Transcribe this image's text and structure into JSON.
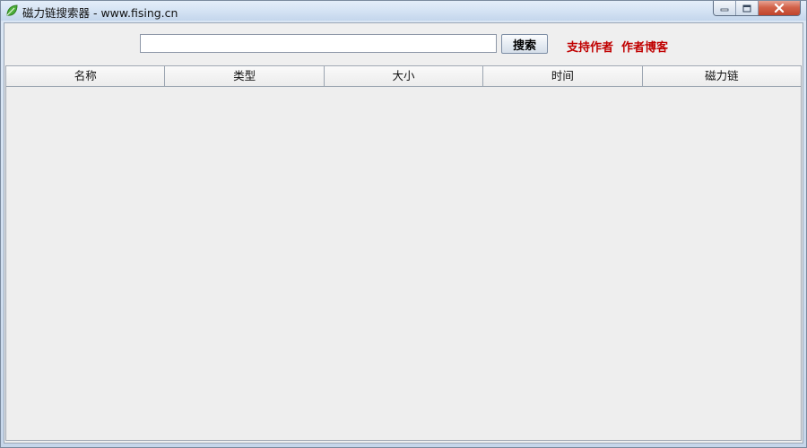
{
  "window": {
    "title": "磁力链搜索器 - www.fising.cn",
    "app_icon": "green-leaf-icon",
    "controls": [
      "minimize-icon",
      "maximize-icon",
      "close-icon"
    ]
  },
  "search": {
    "value": "",
    "placeholder": "",
    "button_label": "搜索"
  },
  "links": {
    "support_author": "支持作者",
    "author_blog": "作者博客"
  },
  "table": {
    "columns": [
      "名称",
      "类型",
      "大小",
      "时间",
      "磁力链"
    ],
    "rows": []
  },
  "colors": {
    "link_red": "#c00000",
    "client_bg": "#efefef"
  }
}
